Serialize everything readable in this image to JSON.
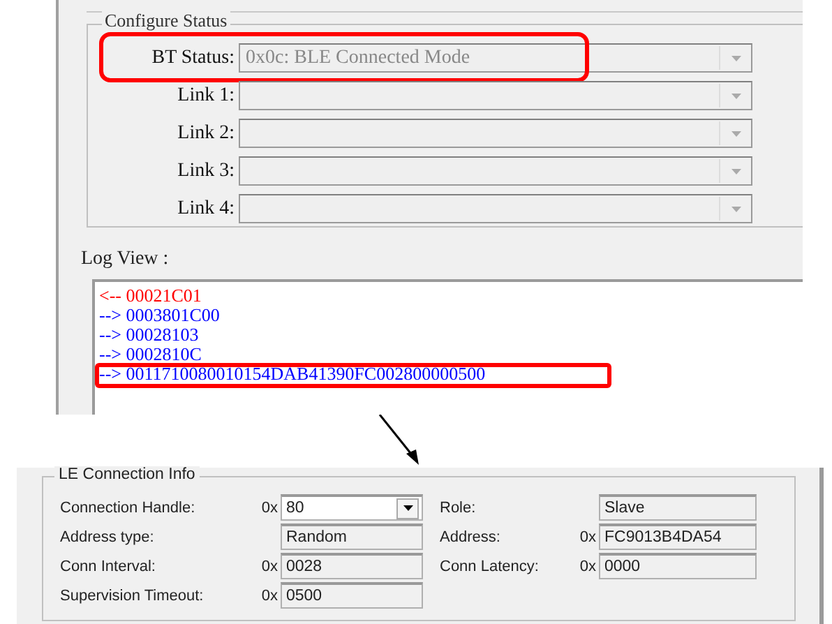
{
  "configure_status": {
    "title": "Configure Status",
    "rows": [
      {
        "label": "BT Status:",
        "value": "0x0c: BLE Connected Mode",
        "highlighted": true
      },
      {
        "label": "Link 1:",
        "value": "",
        "highlighted": false
      },
      {
        "label": "Link 2:",
        "value": "",
        "highlighted": false
      },
      {
        "label": "Link 3:",
        "value": "",
        "highlighted": false
      },
      {
        "label": "Link 4:",
        "value": "",
        "highlighted": false
      }
    ]
  },
  "log_view": {
    "label": "Log View :",
    "lines": [
      {
        "text": "<-- 00021C01",
        "kind": "in",
        "highlighted": false
      },
      {
        "text": "--> 0003801C00",
        "kind": "out",
        "highlighted": false
      },
      {
        "text": "--> 00028103",
        "kind": "out",
        "highlighted": false
      },
      {
        "text": "--> 0002810C",
        "kind": "out",
        "highlighted": false
      },
      {
        "text": "--> 0011710080010154DAB41390FC002800000500",
        "kind": "out",
        "highlighted": true
      }
    ]
  },
  "le_connection_info": {
    "title": "LE Connection Info",
    "fields": [
      {
        "label": "Connection Handle:",
        "prefix": "0x",
        "value": "80",
        "kind": "dropdown"
      },
      {
        "label": "Role:",
        "value": "Slave",
        "kind": "readonly"
      },
      {
        "label": "Address type:",
        "value": "Random",
        "kind": "readonly"
      },
      {
        "label": "Address:",
        "prefix": "0x",
        "value": "FC9013B4DA54",
        "kind": "readonly"
      },
      {
        "label": "Conn Interval:",
        "prefix": "0x",
        "value": "0028",
        "kind": "readonly"
      },
      {
        "label": "Conn Latency:",
        "prefix": "0x",
        "value": "0000",
        "kind": "readonly"
      },
      {
        "label": "Supervision Timeout:",
        "prefix": "0x",
        "value": "0500",
        "kind": "readonly"
      }
    ]
  }
}
